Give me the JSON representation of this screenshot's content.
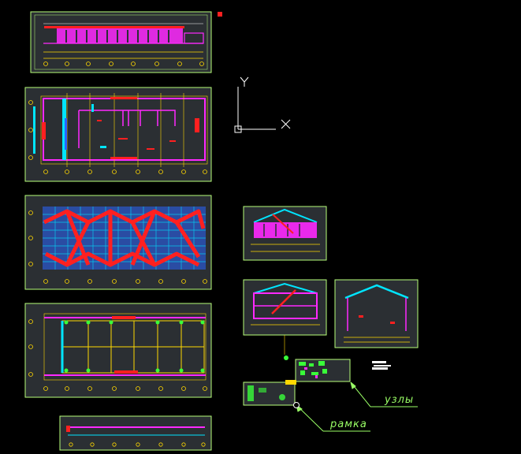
{
  "ucs": {
    "x_label": "X",
    "y_label": "Y"
  },
  "annotations": {
    "nodes_label": "узлы",
    "frame_label": "рамка"
  },
  "colors": {
    "background": "#000000",
    "sheet_frame": "#b7ff7a",
    "sheet_fill": "#2b2f33",
    "magenta": "#ff29ff",
    "red": "#ff2020",
    "yellow": "#ffd800",
    "cyan": "#00e5ff",
    "blue": "#2a64ff",
    "green": "#39ff39",
    "white": "#ffffff",
    "annotation": "#9aff66"
  }
}
